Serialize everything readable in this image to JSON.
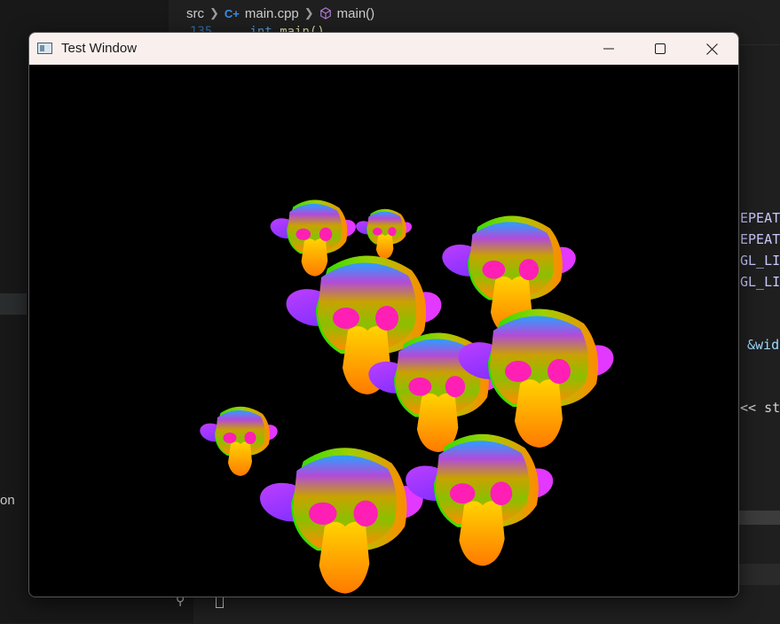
{
  "editor": {
    "breadcrumb": {
      "folder": "src",
      "file": "main.cpp",
      "symbol": "main()",
      "file_icon": "c++-file-icon",
      "symbol_icon": "method-cube-icon"
    },
    "ghost_code": {
      "line_number": "135",
      "keyword": "int",
      "function": "main()"
    },
    "code_fragments": [
      "EPEAT",
      "EPEAT",
      "GL_LI",
      "GL_LI",
      "&wid",
      "<< st"
    ],
    "sidebar_fragment": "on"
  },
  "window": {
    "title": "Test Window",
    "icon": "app-window-icon",
    "controls": {
      "minimize": "minimize-icon",
      "maximize": "maximize-icon",
      "close": "close-icon"
    },
    "scene": {
      "description_icon": "rendered-monkey-heads",
      "colors": {
        "background": "#000000",
        "orange": "#ff9a00",
        "green": "#34e000",
        "magenta": "#ff1fb4",
        "violet": "#b44dff",
        "cyan": "#2aa0ff"
      }
    }
  }
}
